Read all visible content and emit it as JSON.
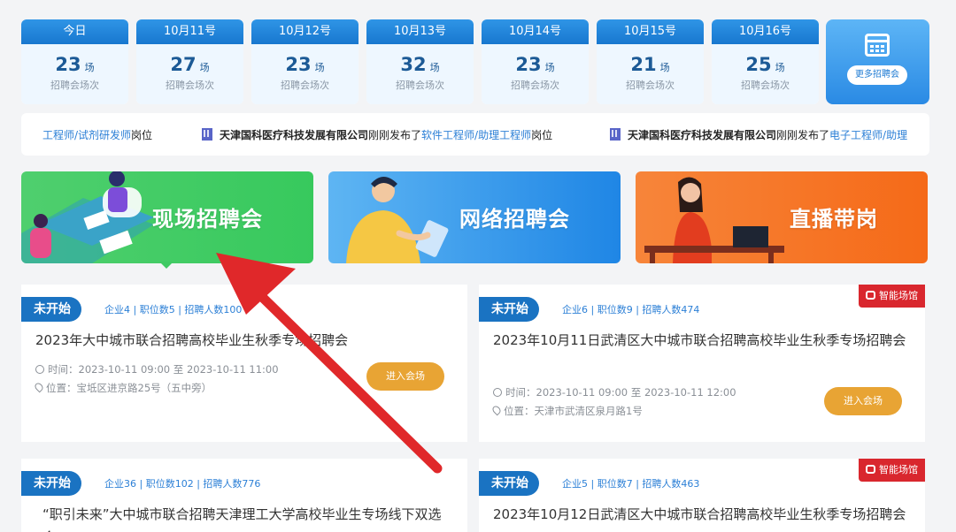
{
  "dates": [
    {
      "label": "今日",
      "count": "23",
      "unit": "场",
      "sub": "招聘会场次"
    },
    {
      "label": "10月11号",
      "count": "27",
      "unit": "场",
      "sub": "招聘会场次"
    },
    {
      "label": "10月12号",
      "count": "23",
      "unit": "场",
      "sub": "招聘会场次"
    },
    {
      "label": "10月13号",
      "count": "32",
      "unit": "场",
      "sub": "招聘会场次"
    },
    {
      "label": "10月14号",
      "count": "23",
      "unit": "场",
      "sub": "招聘会场次"
    },
    {
      "label": "10月15号",
      "count": "21",
      "unit": "场",
      "sub": "招聘会场次"
    },
    {
      "label": "10月16号",
      "count": "25",
      "unit": "场",
      "sub": "招聘会场次"
    }
  ],
  "more_button": "更多招聘会",
  "ticker": {
    "fragment": "工程师/试剂研发师",
    "fragment_suffix": "岗位",
    "items": [
      {
        "company": "天津国科医疗科技发展有限公司",
        "published": "刚刚发布了",
        "job": "软件工程师/助理工程师",
        "suffix": "岗位"
      },
      {
        "company": "天津国科医疗科技发展有限公司",
        "published": "刚刚发布了",
        "job": "电子工程师/助理"
      }
    ]
  },
  "banners": [
    "现场招聘会",
    "网络招聘会",
    "直播带岗"
  ],
  "cards": [
    {
      "status": "未开始",
      "stats": "企业4 | 职位数5 | 招聘人数100",
      "title": "2023年大中城市联合招聘高校毕业生秋季专场招聘会",
      "time": "时间：2023-10-11 09:00 至 2023-10-11 11:00",
      "location": "位置：宝坻区进京路25号（五中旁）",
      "enter": "进入会场"
    },
    {
      "status": "未开始",
      "smart": "智能场馆",
      "stats": "企业6 | 职位数9 | 招聘人数474",
      "title": "2023年10月11日武清区大中城市联合招聘高校毕业生秋季专场招聘会",
      "time": "时间：2023-10-11 09:00 至 2023-10-11 12:00",
      "location": "位置：天津市武清区泉月路1号",
      "enter": "进入会场"
    },
    {
      "status": "未开始",
      "stats": "企业36 | 职位数102 | 招聘人数776",
      "title": "“职引未来”大中城市联合招聘天津理工大学高校毕业生专场线下双选会"
    },
    {
      "status": "未开始",
      "smart": "智能场馆",
      "stats": "企业5 | 职位数7 | 招聘人数463",
      "title": "2023年10月12日武清区大中城市联合招聘高校毕业生秋季专场招聘会"
    }
  ],
  "colors": {
    "primary": "#1a73c2",
    "accent_orange": "#e8a434",
    "smart_red": "#d9272e",
    "arrow": "#e0282a"
  }
}
